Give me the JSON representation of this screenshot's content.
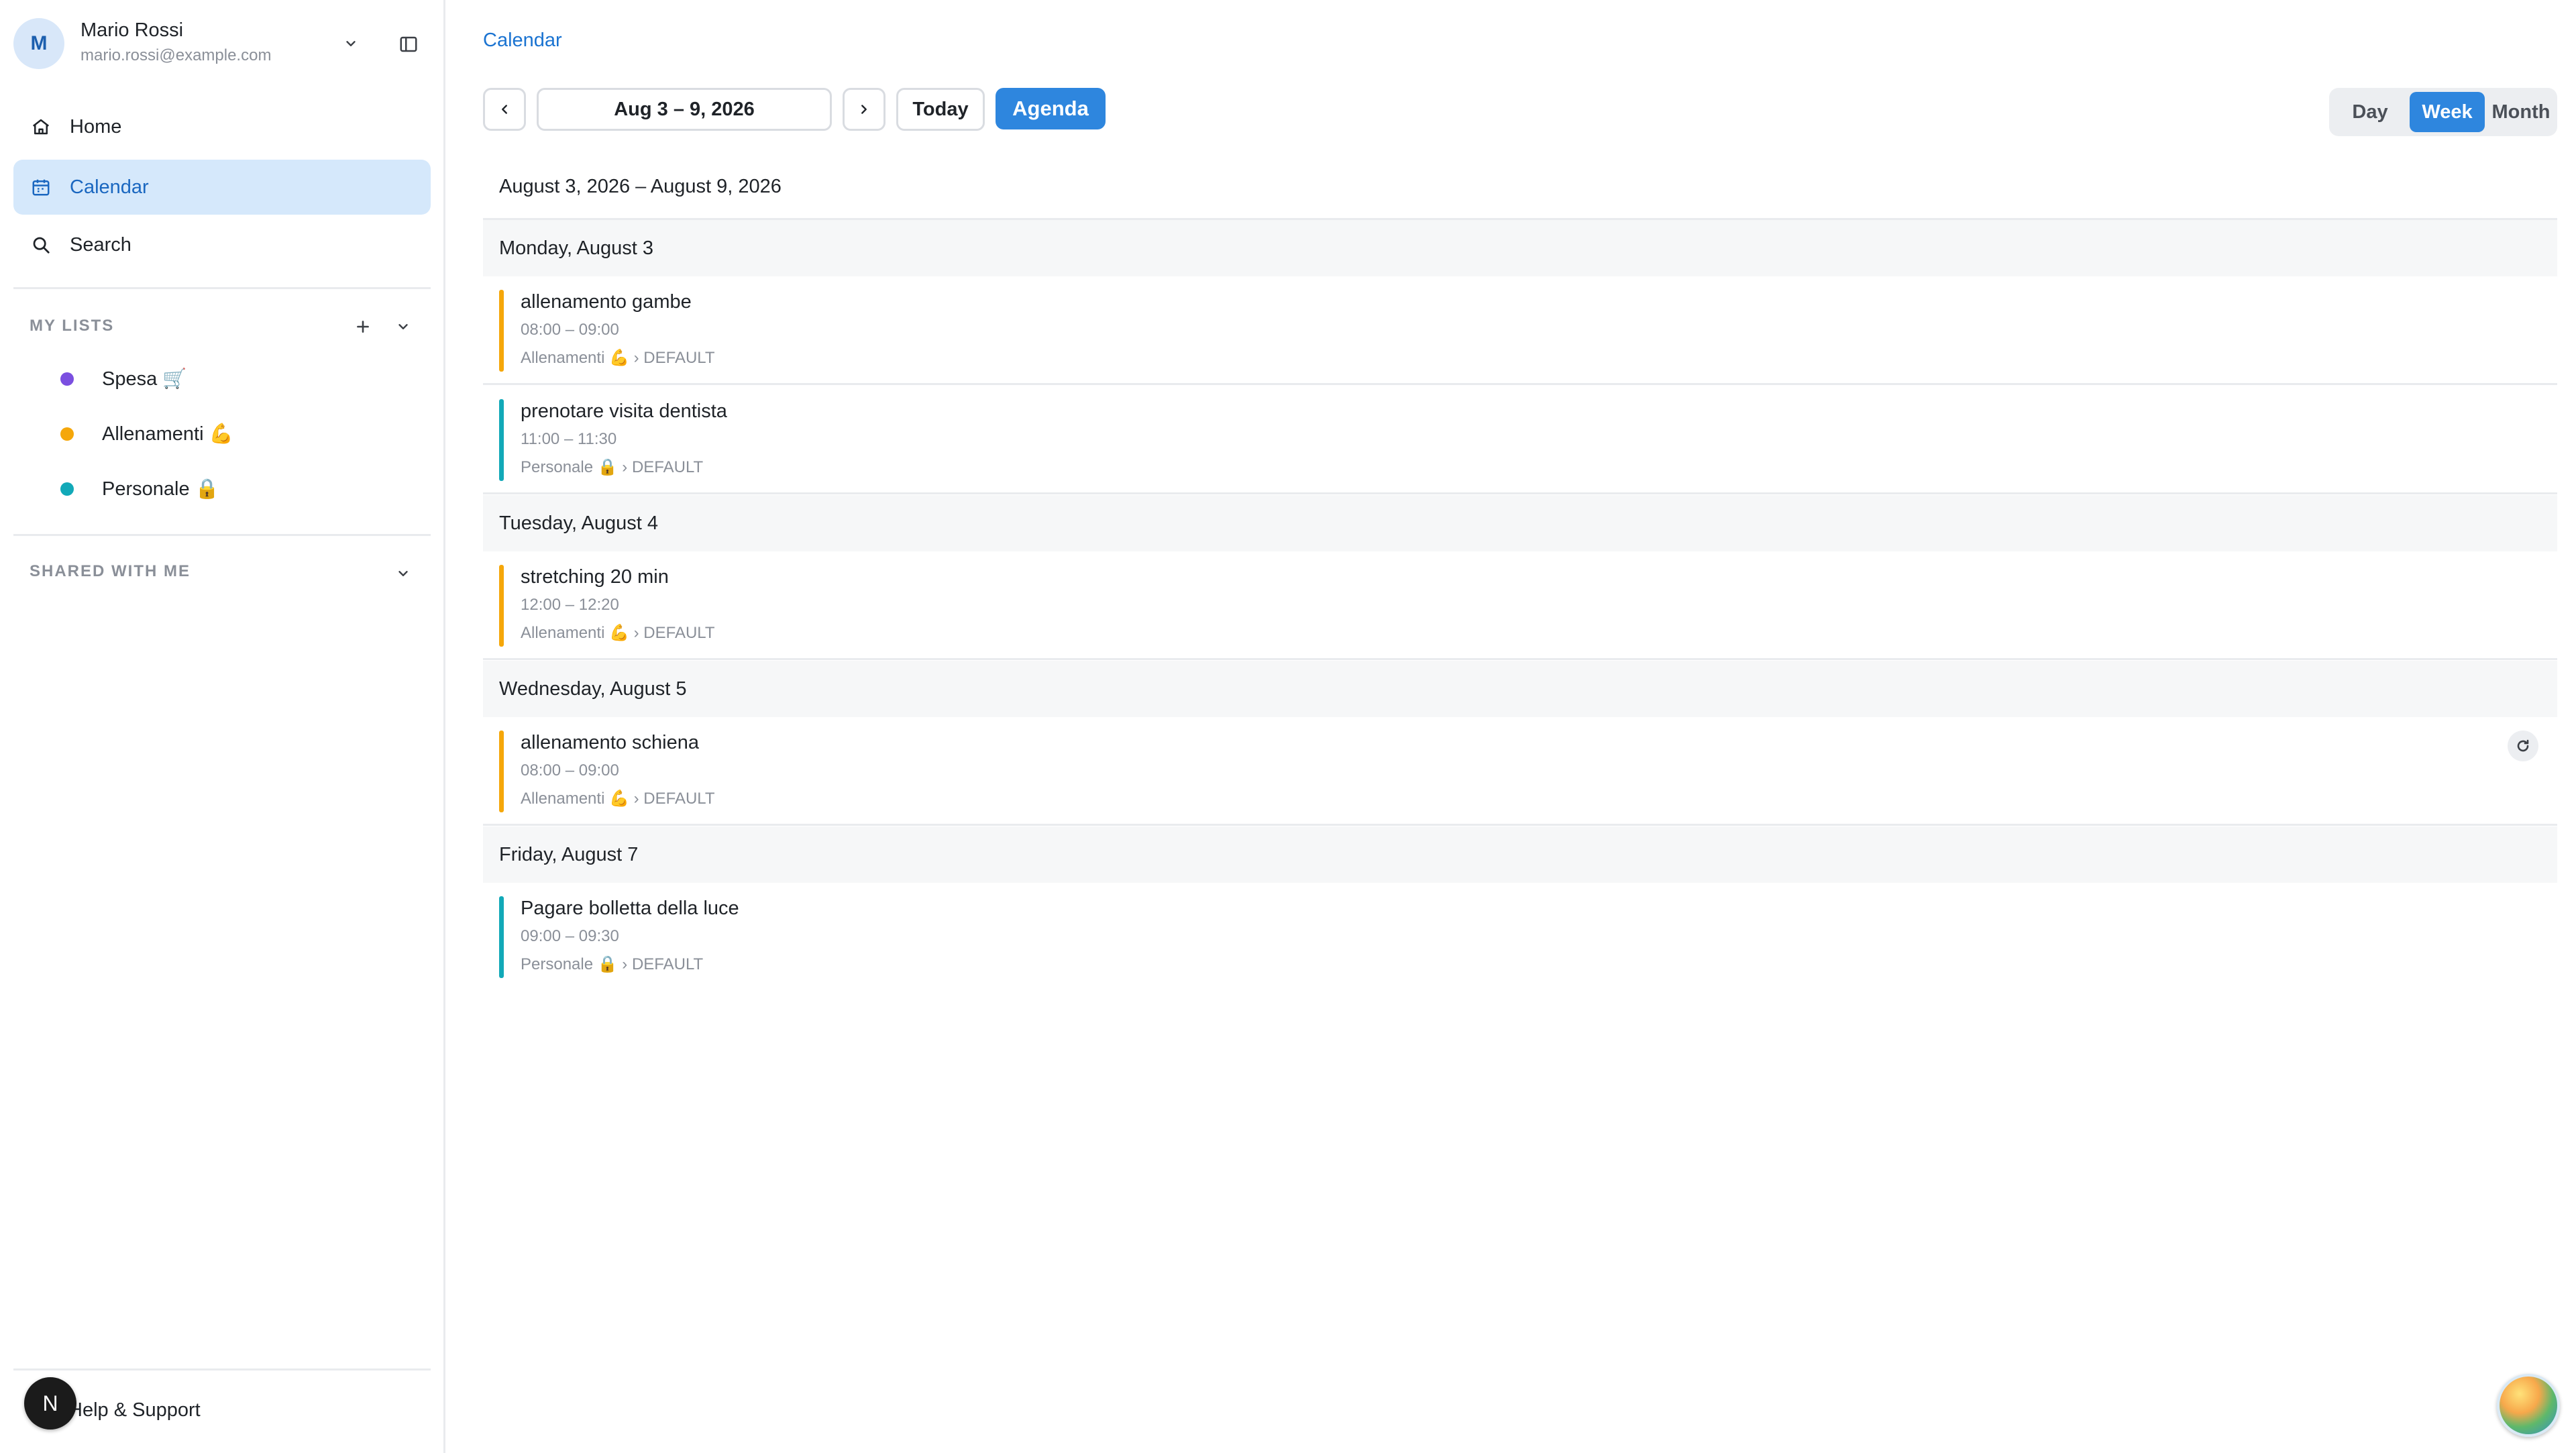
{
  "account": {
    "avatar_initial": "M",
    "name": "Mario Rossi",
    "email": "mario.rossi@example.com"
  },
  "nav": [
    {
      "label": "Home",
      "icon": "home-icon"
    },
    {
      "label": "Calendar",
      "icon": "calendar-icon",
      "active": true
    },
    {
      "label": "Search",
      "icon": "search-icon"
    }
  ],
  "my_lists": {
    "title": "MY LISTS",
    "items": [
      {
        "label": "Spesa 🛒",
        "color": "#7b4fe0"
      },
      {
        "label": "Allenamenti 💪",
        "color": "#f5a70a"
      },
      {
        "label": "Personale 🔒",
        "color": "#12a9b8"
      }
    ]
  },
  "shared": {
    "title": "SHARED WITH ME"
  },
  "help": {
    "label": "Help & Support",
    "badge": "N"
  },
  "breadcrumb": "Calendar",
  "toolbar": {
    "date_range": "Aug 3 – 9, 2026",
    "today": "Today",
    "agenda": "Agenda",
    "views": [
      {
        "label": "Day"
      },
      {
        "label": "Week",
        "active": true
      },
      {
        "label": "Month"
      }
    ]
  },
  "agenda": {
    "range_title": "August 3, 2026 – August 9, 2026",
    "days": [
      {
        "header": "Monday, August 3",
        "events": [
          {
            "title": "allenamento gambe",
            "time": "08:00 – 09:00",
            "meta": "Allenamenti 💪 › DEFAULT",
            "color": "#f5a70a"
          },
          {
            "title": "prenotare visita dentista",
            "time": "11:00 – 11:30",
            "meta": "Personale 🔒 › DEFAULT",
            "color": "#12a9b8"
          }
        ]
      },
      {
        "header": "Tuesday, August 4",
        "events": [
          {
            "title": "stretching 20 min",
            "time": "12:00 – 12:20",
            "meta": "Allenamenti 💪 › DEFAULT",
            "color": "#f5a70a"
          }
        ]
      },
      {
        "header": "Wednesday, August 5",
        "events": [
          {
            "title": "allenamento schiena",
            "time": "08:00 – 09:00",
            "meta": "Allenamenti 💪 › DEFAULT",
            "color": "#f5a70a",
            "recurring": true
          }
        ]
      },
      {
        "header": "Friday, August 7",
        "events": [
          {
            "title": "Pagare bolletta della luce",
            "time": "09:00 – 09:30",
            "meta": "Personale 🔒 › DEFAULT",
            "color": "#12a9b8"
          }
        ]
      }
    ]
  }
}
